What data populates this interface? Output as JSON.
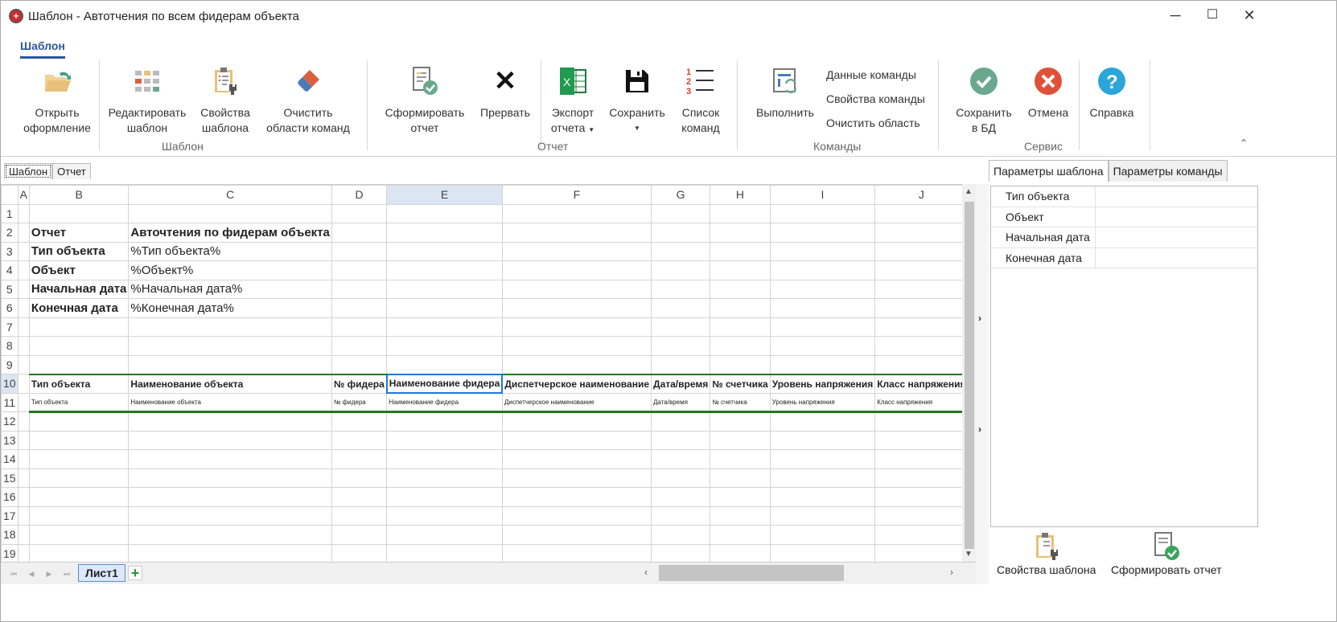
{
  "window": {
    "title": "Шаблон - Автотчения по всем фидерам объекта",
    "minimize": "─",
    "maximize": "☐",
    "close": "✕"
  },
  "ribbon": {
    "tab": "Шаблон",
    "groups": {
      "template": "Шаблон",
      "report": "Отчет",
      "commands": "Команды",
      "service": "Сервис"
    },
    "buttons": {
      "open": [
        "Открыть",
        "оформление"
      ],
      "edit": [
        "Редактировать",
        "шаблон"
      ],
      "props": [
        "Свойства",
        "шаблона"
      ],
      "clear": [
        "Очистить",
        "области команд"
      ],
      "form": [
        "Сформировать",
        "отчет"
      ],
      "abort": [
        "Прервать"
      ],
      "export": [
        "Экспорт",
        "отчета"
      ],
      "save": [
        "Сохранить"
      ],
      "list": [
        "Список",
        "команд"
      ],
      "run": [
        "Выполнить"
      ],
      "savedb": [
        "Сохранить",
        "в БД"
      ],
      "cancel": [
        "Отмена"
      ],
      "help": [
        "Справка"
      ]
    },
    "small": {
      "cmd_data": "Данные команды",
      "cmd_props": "Свойства команды",
      "clear_area": "Очистить область"
    }
  },
  "doc_tabs": [
    "Шаблон",
    "Отчет"
  ],
  "sheet": {
    "columns": [
      "A",
      "B",
      "C",
      "D",
      "E",
      "F",
      "G",
      "H",
      "I",
      "J"
    ],
    "rows": [
      "1",
      "2",
      "3",
      "4",
      "5",
      "6",
      "7",
      "8",
      "9",
      "10",
      "11",
      "12",
      "13",
      "14",
      "15",
      "16",
      "17",
      "18",
      "19"
    ],
    "cells": {
      "r2": [
        "",
        "Отчет",
        "Авточтения по фидерам объекта"
      ],
      "r3": [
        "",
        "Тип объекта",
        "%Тип объекта%"
      ],
      "r4": [
        "",
        "Объект",
        "%Объект%"
      ],
      "r5": [
        "",
        "Начальная дата",
        "%Начальная дата%"
      ],
      "r6": [
        "",
        "Конечная дата",
        "%Конечная дата%"
      ],
      "r10": [
        "",
        "Тип объекта",
        "Наименование объекта",
        "№ фидера",
        "Наименование фидера",
        "Диспетчерское наименование",
        "Дата/время",
        "№ счетчика",
        "Уровень напряжения",
        "Класс напряжения"
      ],
      "r11": [
        "",
        "Тип объекта",
        "Наименование объекта",
        "№ фидера",
        "Наименование фидера",
        "Диспетчерское наименование",
        "Дата/время",
        "№ счетчика",
        "Уровень напряжения",
        "Класс напряжения"
      ]
    },
    "sheet_tab": "Лист1",
    "add_sheet": "+"
  },
  "panel": {
    "tabs": [
      "Параметры шаблона",
      "Параметры команды"
    ],
    "params": [
      "Тип объекта",
      "Объект",
      "Начальная дата",
      "Конечная дата"
    ],
    "buttons": {
      "props": "Свойства шаблона",
      "form": "Сформировать отчет"
    }
  }
}
